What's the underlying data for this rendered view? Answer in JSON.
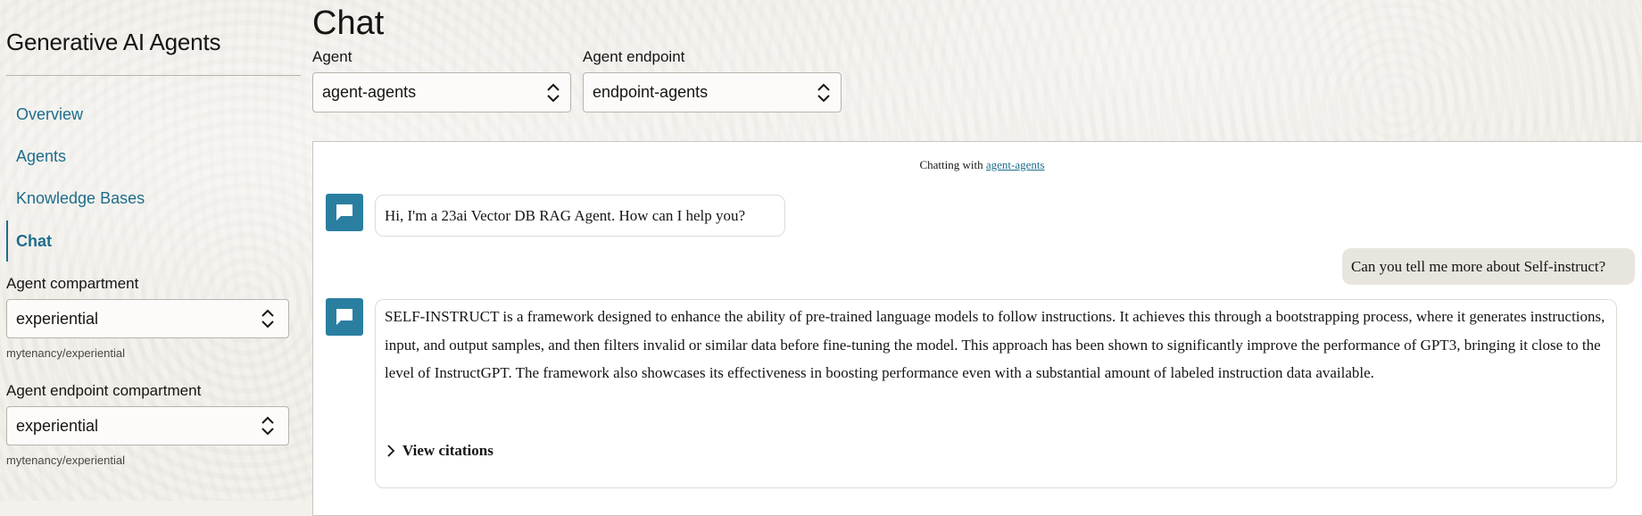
{
  "sidebar": {
    "app_title": "Generative AI Agents",
    "nav": [
      {
        "label": "Overview",
        "active": false
      },
      {
        "label": "Agents",
        "active": false
      },
      {
        "label": "Knowledge Bases",
        "active": false
      },
      {
        "label": "Chat",
        "active": true
      }
    ],
    "agent_compartment": {
      "label": "Agent compartment",
      "value": "experiential",
      "hint": "mytenancy/experiential"
    },
    "endpoint_compartment": {
      "label": "Agent endpoint compartment",
      "value": "experiential",
      "hint": "mytenancy/experiential"
    }
  },
  "main": {
    "title": "Chat",
    "agent": {
      "label": "Agent",
      "value": "agent-agents"
    },
    "endpoint": {
      "label": "Agent endpoint",
      "value": "endpoint-agents"
    }
  },
  "chat": {
    "header_prefix": "Chatting with",
    "header_link": "agent-agents",
    "messages": [
      {
        "role": "agent",
        "text": "Hi, I'm a 23ai Vector DB RAG Agent. How can I help you?"
      },
      {
        "role": "user",
        "text": "Can you tell me more about Self-instruct?"
      },
      {
        "role": "agent",
        "text": "SELF-INSTRUCT is a framework designed to enhance the ability of pre-trained language models to follow instructions. It achieves this through a bootstrapping process, where it generates instructions, input, and output samples, and then filters invalid or similar data before fine-tuning the model. This approach has been shown to significantly improve the performance of GPT3, bringing it close to the level of InstructGPT. The framework also showcases its effectiveness in boosting performance even with a substantial amount of labeled instruction data available.",
        "citations_label": "View citations"
      }
    ]
  },
  "colors": {
    "accent": "#1e6d8c",
    "avatar": "#2a7fa1",
    "background": "#f3f1ec",
    "user_bubble": "#e8e5df"
  },
  "icons": {
    "select": "updown-chevron-icon",
    "avatar": "chat-bubble-icon",
    "citations": "chevron-right-icon"
  }
}
